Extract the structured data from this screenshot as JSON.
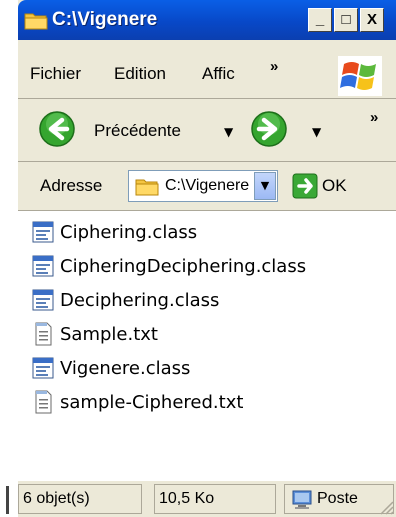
{
  "window": {
    "title": "C:\\Vigenere",
    "minimize_label": "_",
    "maximize_label": "□",
    "close_label": "X"
  },
  "menu": {
    "items": [
      "Fichier",
      "Edition",
      "Affic"
    ],
    "more": "»"
  },
  "toolbar": {
    "back_label": "Précédente",
    "more": "»"
  },
  "address": {
    "label": "Adresse",
    "value": "C:\\Vigenere",
    "go_label": "OK"
  },
  "files": [
    {
      "name": "Ciphering.class",
      "icon": "class-file-icon"
    },
    {
      "name": "CipheringDeciphering.class",
      "icon": "class-file-icon"
    },
    {
      "name": "Deciphering.class",
      "icon": "class-file-icon"
    },
    {
      "name": "Sample.txt",
      "icon": "text-file-icon"
    },
    {
      "name": "Vigenere.class",
      "icon": "class-file-icon"
    },
    {
      "name": "sample-Ciphered.txt",
      "icon": "text-file-icon"
    }
  ],
  "status": {
    "objects": "6 objet(s)",
    "size": "10,5 Ko",
    "zone": "Poste"
  },
  "colors": {
    "titlebar": "#0848c8",
    "chrome": "#ece9d8",
    "nav_green": "#2f9a2a"
  }
}
